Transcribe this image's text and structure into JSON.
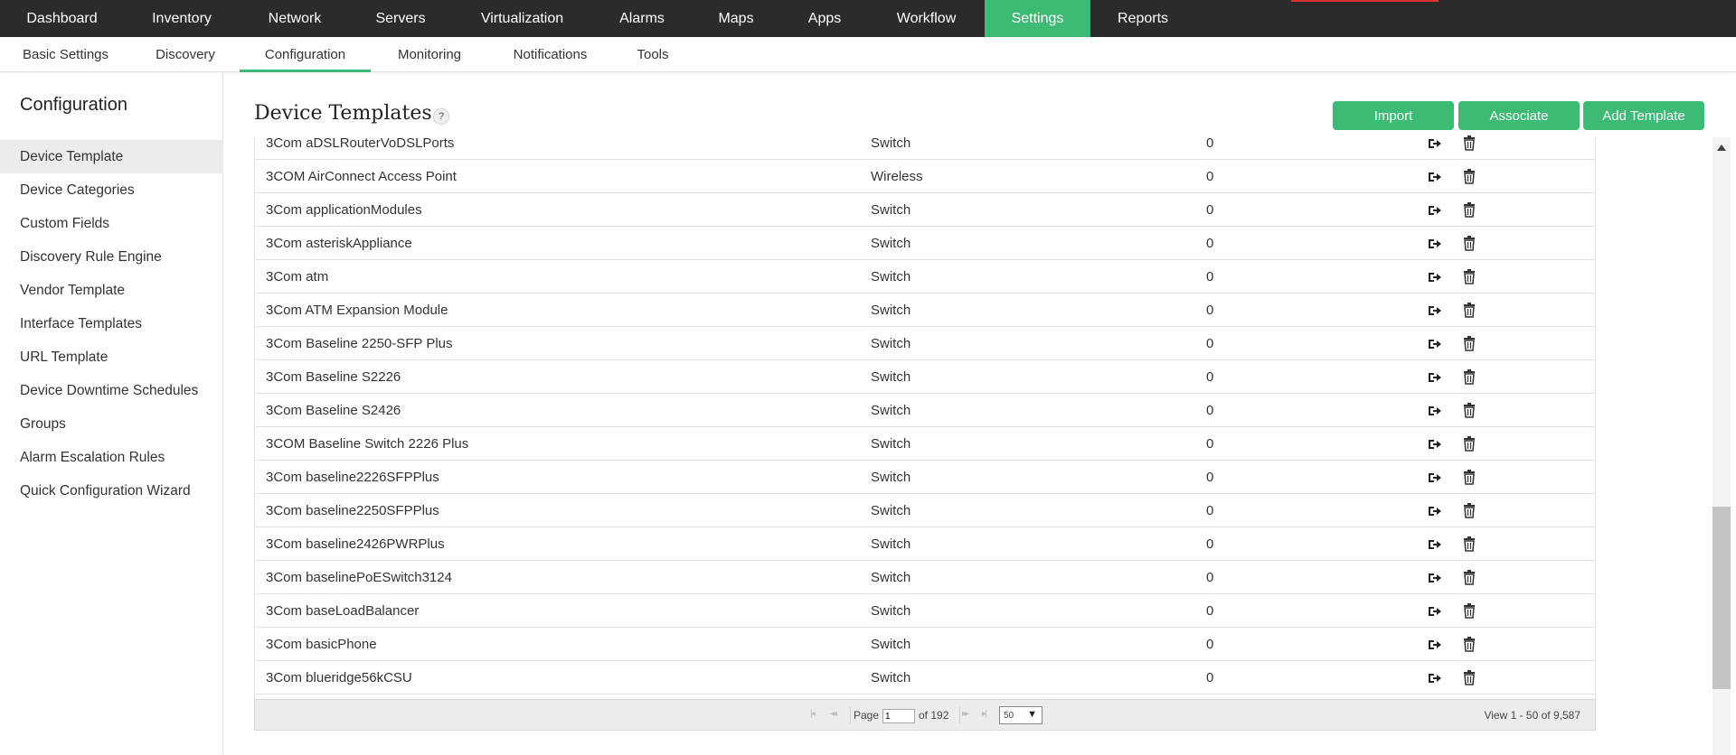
{
  "top_nav": {
    "items": [
      "Dashboard",
      "Inventory",
      "Network",
      "Servers",
      "Virtualization",
      "Alarms",
      "Maps",
      "Apps",
      "Workflow",
      "Settings",
      "Reports"
    ],
    "active": "Settings",
    "active_color": "#3dba74"
  },
  "sub_nav": {
    "items": [
      "Basic Settings",
      "Discovery",
      "Configuration",
      "Monitoring",
      "Notifications",
      "Tools"
    ],
    "active": "Configuration"
  },
  "sidebar": {
    "title": "Configuration",
    "items": [
      "Device Template",
      "Device Categories",
      "Custom Fields",
      "Discovery Rule Engine",
      "Vendor Template",
      "Interface Templates",
      "URL Template",
      "Device Downtime Schedules",
      "Groups",
      "Alarm Escalation Rules",
      "Quick Configuration Wizard"
    ],
    "active": "Device Template"
  },
  "main": {
    "title": "Device Templates",
    "help_label": "?",
    "buttons": {
      "import": "Import",
      "associate": "Associate",
      "add_template": "Add Template"
    }
  },
  "table": {
    "rows": [
      {
        "name": "3Com aDSLRouterVoDSLPorts",
        "category": "Switch",
        "count": "0"
      },
      {
        "name": "3COM AirConnect Access Point",
        "category": "Wireless",
        "count": "0"
      },
      {
        "name": "3Com applicationModules",
        "category": "Switch",
        "count": "0"
      },
      {
        "name": "3Com asteriskAppliance",
        "category": "Switch",
        "count": "0"
      },
      {
        "name": "3Com atm",
        "category": "Switch",
        "count": "0"
      },
      {
        "name": "3Com ATM Expansion Module",
        "category": "Switch",
        "count": "0"
      },
      {
        "name": "3Com Baseline 2250-SFP Plus",
        "category": "Switch",
        "count": "0"
      },
      {
        "name": "3Com Baseline S2226",
        "category": "Switch",
        "count": "0"
      },
      {
        "name": "3Com Baseline S2426",
        "category": "Switch",
        "count": "0"
      },
      {
        "name": "3COM Baseline Switch 2226 Plus",
        "category": "Switch",
        "count": "0"
      },
      {
        "name": "3Com baseline2226SFPPlus",
        "category": "Switch",
        "count": "0"
      },
      {
        "name": "3Com baseline2250SFPPlus",
        "category": "Switch",
        "count": "0"
      },
      {
        "name": "3Com baseline2426PWRPlus",
        "category": "Switch",
        "count": "0"
      },
      {
        "name": "3Com baselinePoESwitch3124",
        "category": "Switch",
        "count": "0"
      },
      {
        "name": "3Com baseLoadBalancer",
        "category": "Switch",
        "count": "0"
      },
      {
        "name": "3Com basicPhone",
        "category": "Switch",
        "count": "0"
      },
      {
        "name": "3Com blueridge56kCSU",
        "category": "Switch",
        "count": "0"
      }
    ],
    "row_actions": [
      "export-icon",
      "delete-icon"
    ]
  },
  "pager": {
    "page_label": "Page",
    "page_value": "1",
    "of_label": "of 192",
    "per_page": "50",
    "view_text": "View 1 - 50 of 9,587"
  }
}
